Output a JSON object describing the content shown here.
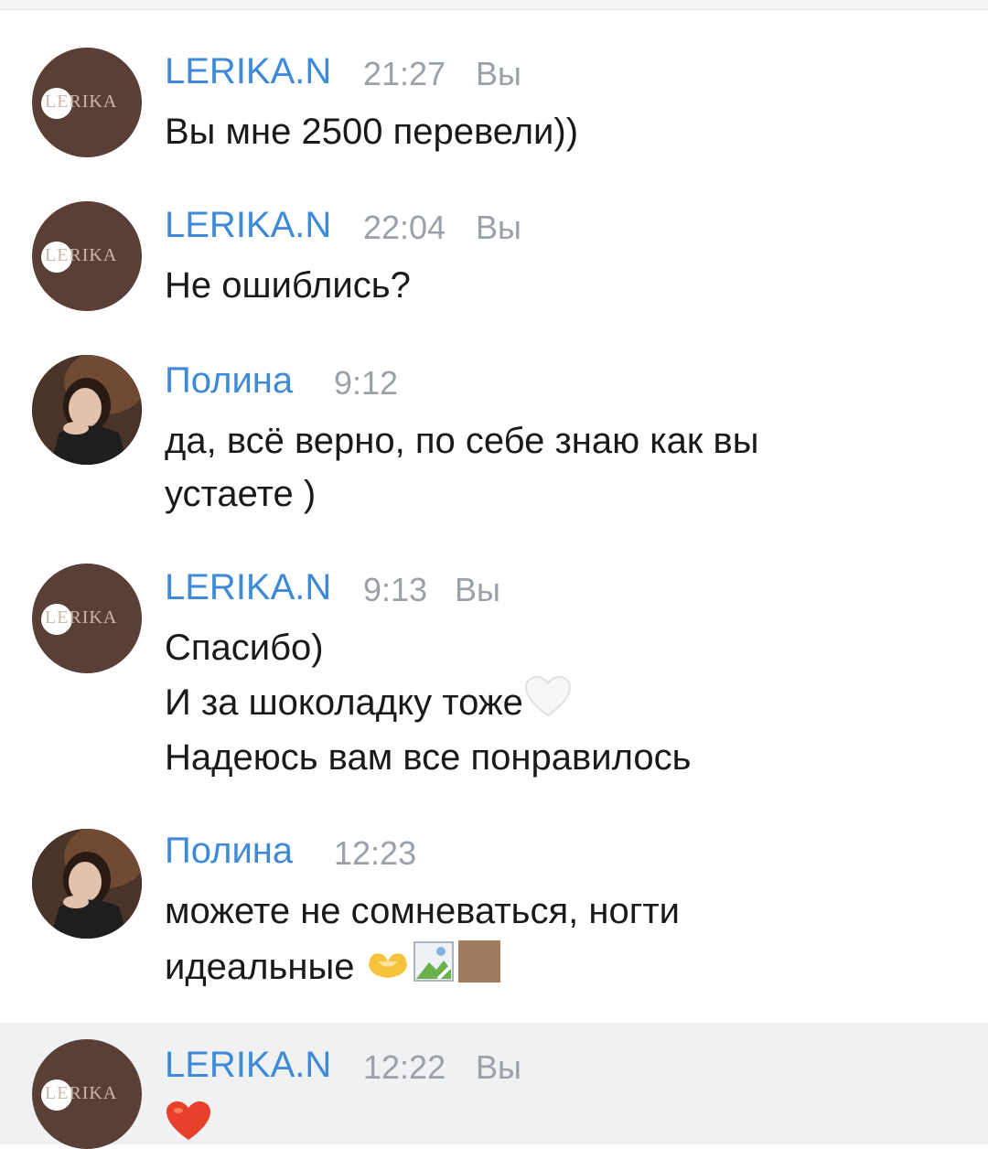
{
  "messages": [
    {
      "author": "LERIKA.N",
      "time": "21:27",
      "you": "Вы",
      "avatar_logo": "LERIKA",
      "lines": [
        "Вы мне 2500 перевели))"
      ]
    },
    {
      "author": "LERIKA.N",
      "time": "22:04",
      "you": "Вы",
      "avatar_logo": "LERIKA",
      "lines": [
        "Не ошиблись?"
      ]
    },
    {
      "author": "Полина",
      "time": "9:12",
      "lines": [
        "да, всё верно, по себе знаю как вы",
        "устаете )"
      ]
    },
    {
      "author": "LERIKA.N",
      "time": "9:13",
      "you": "Вы",
      "avatar_logo": "LERIKA",
      "lines": [
        "Спасибо)",
        "И за шоколадку тоже",
        "Надеюсь вам все понравилось"
      ]
    },
    {
      "author": "Полина",
      "time": "12:23",
      "lines": [
        "можете не сомневаться, ногти",
        "идеальные"
      ]
    },
    {
      "author": "LERIKA.N",
      "time": "12:22",
      "you": "Вы",
      "avatar_logo": "LERIKA",
      "lines": [
        ""
      ]
    }
  ],
  "colors": {
    "author_name": "#3f8ad8",
    "timestamp": "#9aa1a8",
    "message_text": "#1a1a1a",
    "lerika_avatar_bg": "#5a3f37",
    "highlight_row": "#f0f1f3",
    "heart_red": "#e8402a"
  },
  "icons": {
    "white_heart": "white-heart-icon",
    "heart_hands": "heart-hands-icon",
    "broken_image": "broken-image-icon",
    "brown_square": "brown-square-icon",
    "red_heart": "red-heart-icon"
  }
}
